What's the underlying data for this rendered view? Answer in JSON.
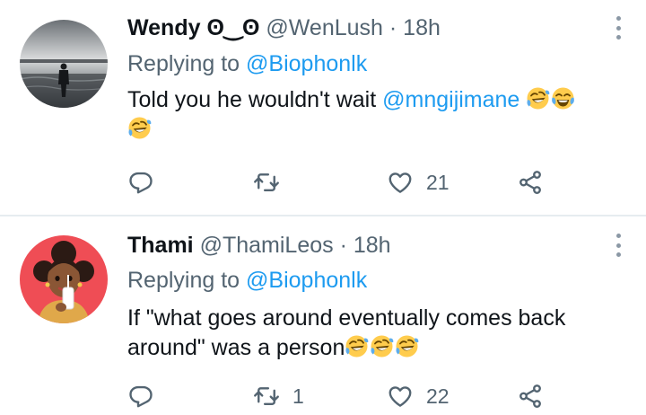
{
  "tweets": [
    {
      "name": "Wendy ʘ‿ʘ",
      "handle": "@WenLush",
      "dot": "·",
      "time": "18h",
      "replying_prefix": "Replying to",
      "replying_to": "@Biophonlk",
      "text": "Told you he wouldn't wait",
      "mention": "@mngijimane",
      "emojis": [
        "rolling-on-floor-laughing",
        "face-with-tears-of-joy",
        "rolling-on-floor-laughing"
      ],
      "reply_count": "",
      "retweet_count": "",
      "like_count": "21"
    },
    {
      "name": "Thami",
      "handle": "@ThamiLeos",
      "dot": "·",
      "time": "18h",
      "replying_prefix": "Replying to",
      "replying_to": "@Biophonlk",
      "text": "If \"what goes around eventually comes back around\" was a person",
      "emojis": [
        "rolling-on-floor-laughing",
        "rolling-on-floor-laughing",
        "rolling-on-floor-laughing"
      ],
      "reply_count": "",
      "retweet_count": "1",
      "like_count": "22"
    }
  ],
  "icons": [
    "reply-icon",
    "retweet-icon",
    "like-icon",
    "share-icon",
    "more-icon"
  ],
  "colors": {
    "link": "#1d9bf0",
    "muted": "#536471",
    "divider": "#e6ecf0"
  }
}
